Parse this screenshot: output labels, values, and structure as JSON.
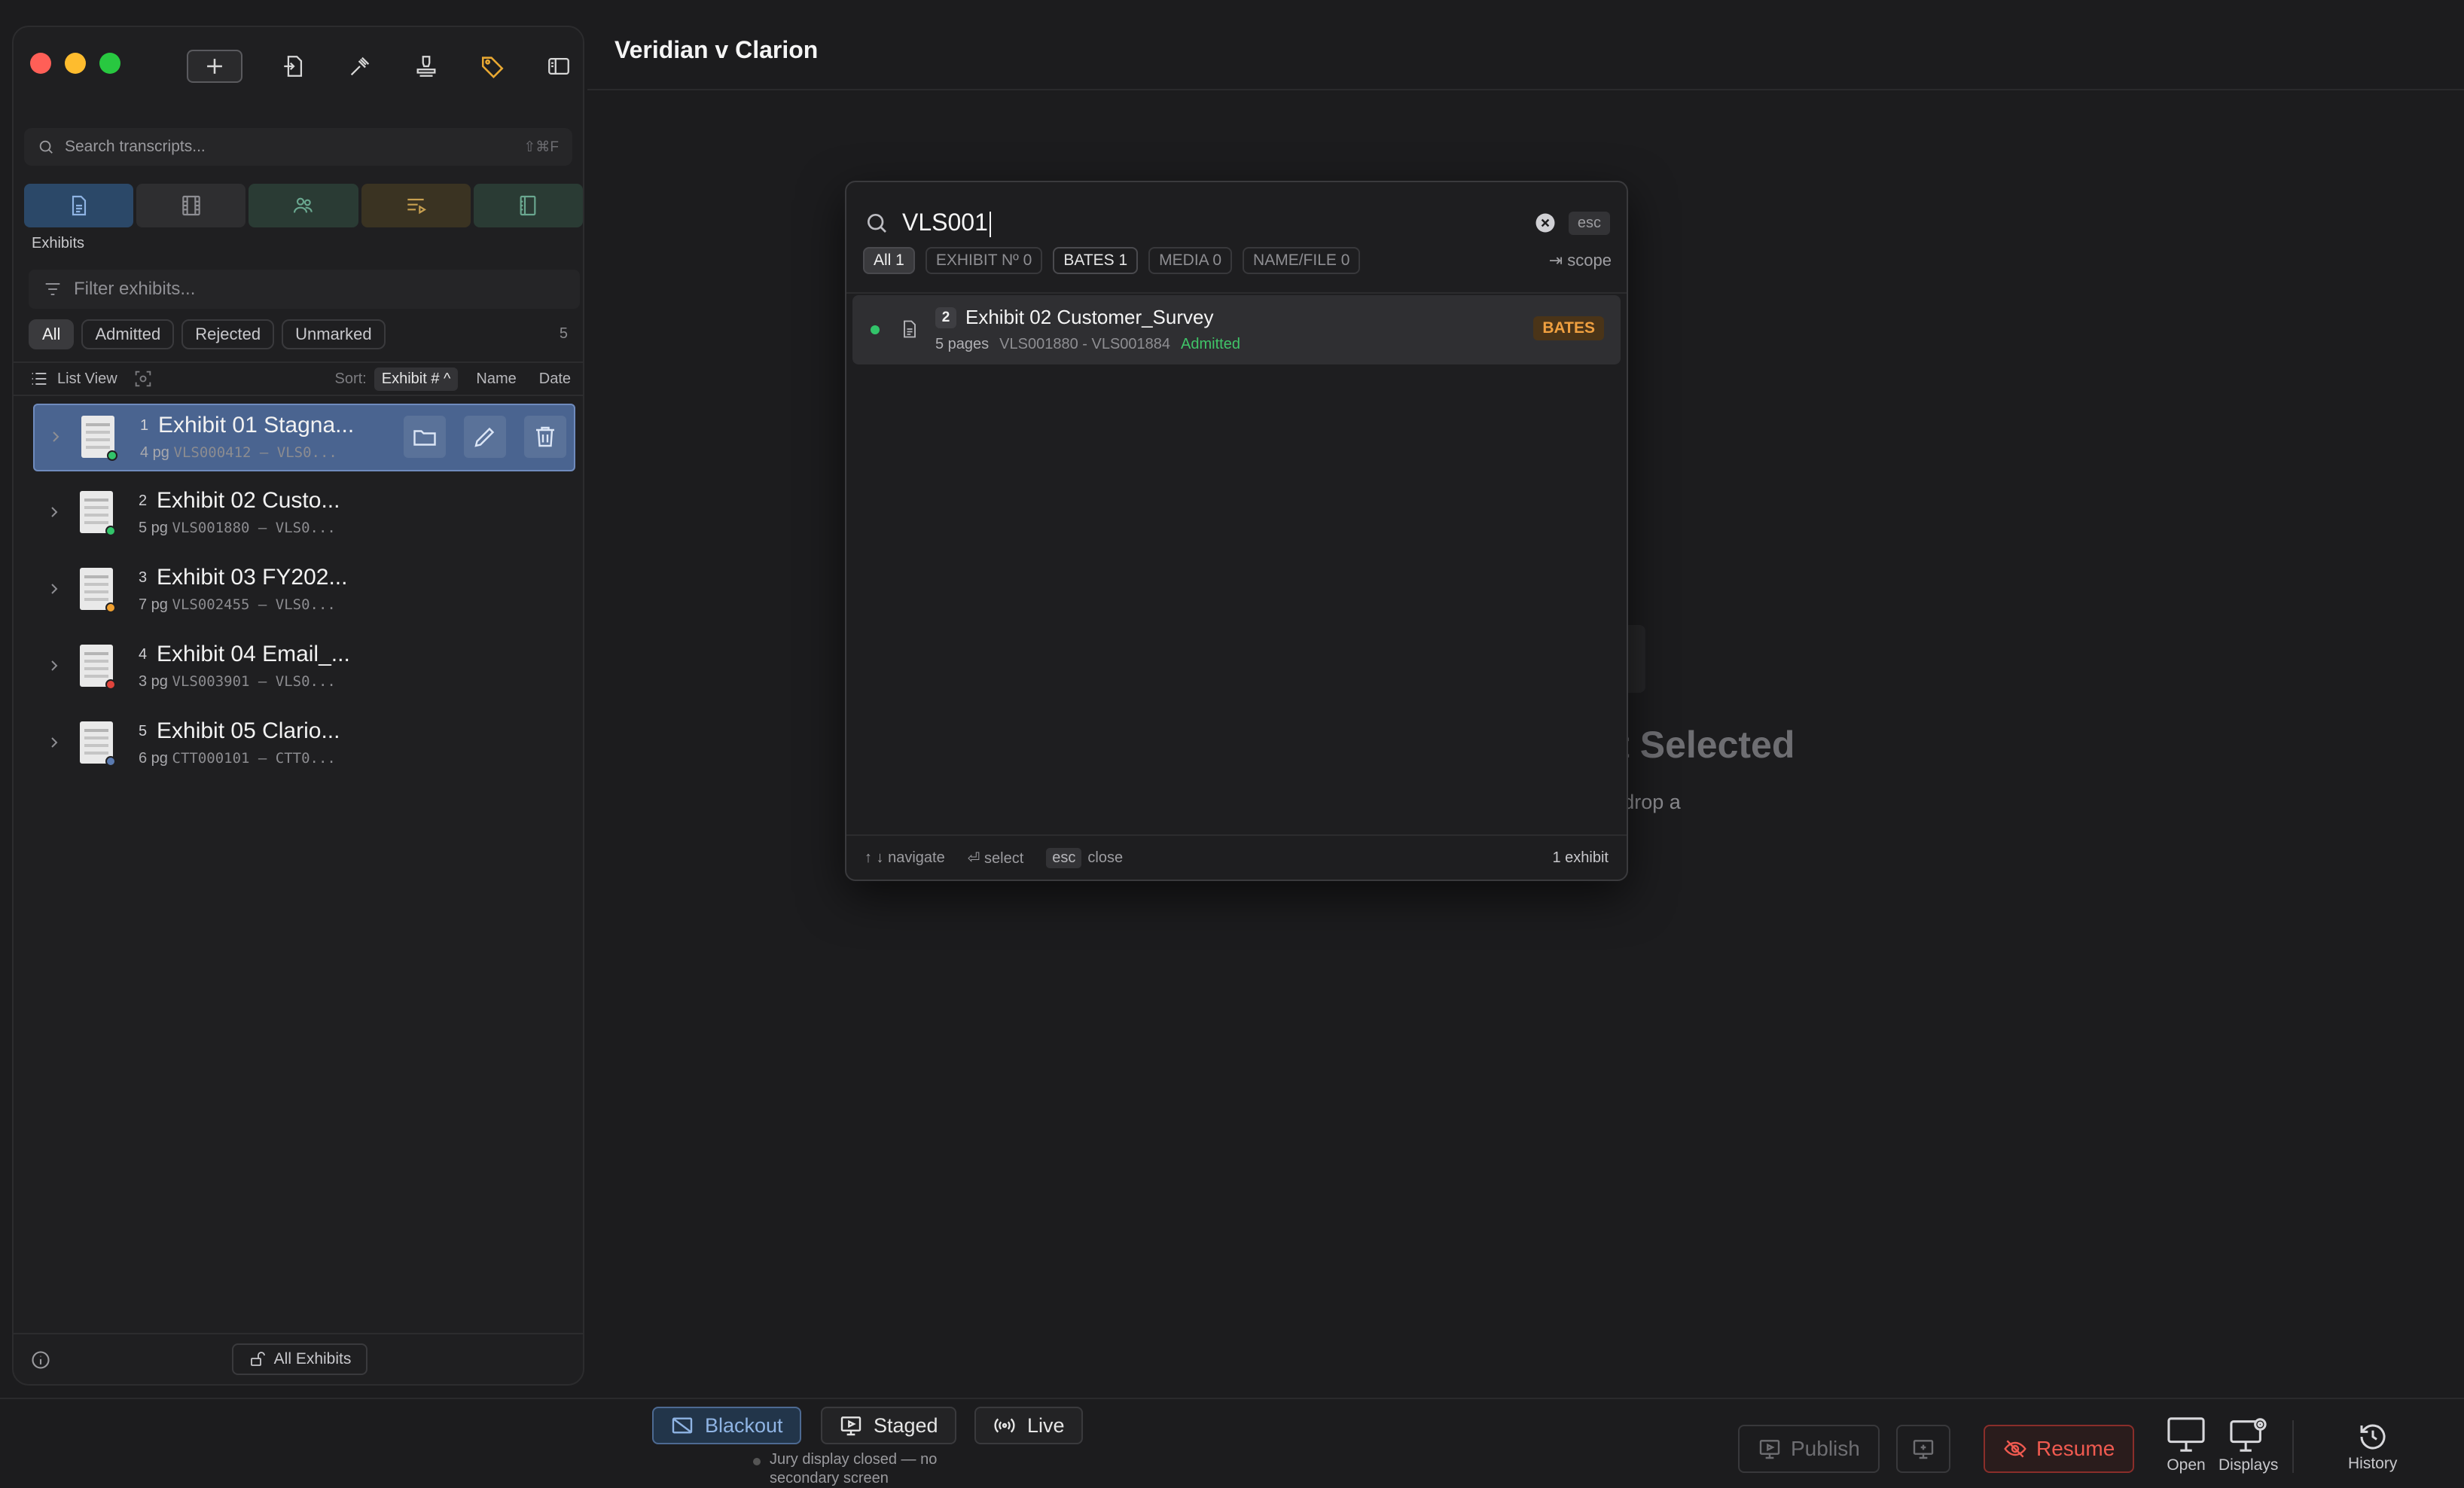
{
  "app": {
    "case_title": "Veridian v Clarion"
  },
  "sidebar": {
    "search_placeholder": "Search transcripts...",
    "search_shortcut": "⇧⌘F",
    "section_label": "Exhibits",
    "filter_placeholder": "Filter exhibits...",
    "chips": [
      "All",
      "Admitted",
      "Rejected",
      "Unmarked"
    ],
    "chip_count": "5",
    "list_view_label": "List View",
    "sort_label": "Sort:",
    "sort_value": "Exhibit # ^",
    "sort_cols": [
      "Name",
      "Date"
    ],
    "exhibits": [
      {
        "num": "1",
        "title": "Exhibit 01 Stagna...",
        "pages": "4 pg",
        "bates": "VLS000412 – VLS0...",
        "status_color": "#32c46a"
      },
      {
        "num": "2",
        "title": "Exhibit 02 Custo...",
        "pages": "5 pg",
        "bates": "VLS001880 – VLS0...",
        "status_color": "#32c46a"
      },
      {
        "num": "3",
        "title": "Exhibit 03 FY202...",
        "pages": "7 pg",
        "bates": "VLS002455 – VLS0...",
        "status_color": "#f0a030"
      },
      {
        "num": "4",
        "title": "Exhibit 04 Email_...",
        "pages": "3 pg",
        "bates": "VLS003901 – VLS0...",
        "status_color": "#e0443c"
      },
      {
        "num": "5",
        "title": "Exhibit 05 Clario...",
        "pages": "6 pg",
        "bates": "CTT000101 – CTT0...",
        "status_color": "#5a7ab0"
      }
    ],
    "footer_button": "All Exhibits"
  },
  "empty_state": {
    "title": "No Exhibit Selected",
    "subtitle": "drag & drop a"
  },
  "palette": {
    "query": "VLS001",
    "esc_label": "esc",
    "filters": [
      {
        "label": "All 1",
        "state": "on"
      },
      {
        "label": "EXHIBIT Nº 0",
        "state": "off"
      },
      {
        "label": "BATES 1",
        "state": "strong"
      },
      {
        "label": "MEDIA 0",
        "state": "off"
      },
      {
        "label": "NAME/FILE 0",
        "state": "off"
      }
    ],
    "scope_label": "⇥ scope",
    "result": {
      "num": "2",
      "title": "Exhibit 02 Customer_Survey",
      "pages": "5 pages",
      "bates": "VLS001880 - VLS001884",
      "status": "Admitted",
      "tag": "BATES"
    },
    "footer": {
      "navigate": "↑ ↓ navigate",
      "select": "⏎ select",
      "close_key": "esc",
      "close": "close",
      "count": "1 exhibit"
    }
  },
  "bottom_bar": {
    "modes": [
      "Blackout",
      "Staged",
      "Live"
    ],
    "jury_status_line1": "Jury display closed — no",
    "jury_status_line2": "secondary screen",
    "publish": "Publish",
    "resume": "Resume",
    "open": "Open",
    "displays": "Displays",
    "history": "History"
  },
  "colors": {
    "accent": "#4a6490",
    "admitted": "#32c46a",
    "bates_tag": "#f0a040",
    "resume": "#f05a50"
  }
}
